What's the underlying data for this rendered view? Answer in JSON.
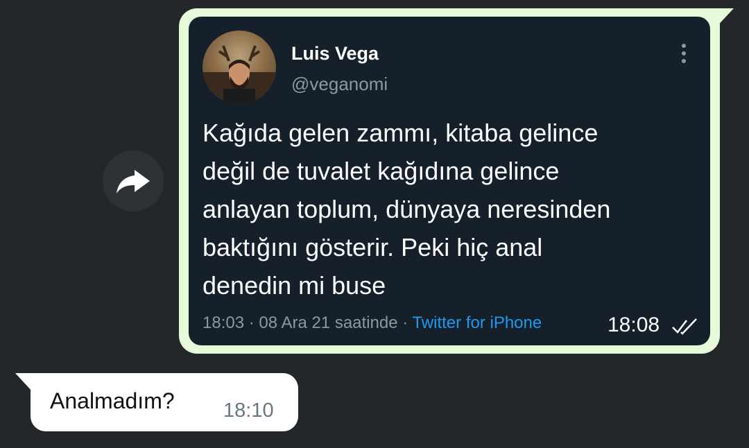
{
  "colors": {
    "chat_background": "#24272a",
    "outgoing_bubble": "#e6f9d8",
    "incoming_bubble": "#ffffff",
    "tweet_card_background": "#15202b",
    "link_blue": "#1d9bf0"
  },
  "forward_button": {
    "icon": "share-forward-icon"
  },
  "outgoing_message": {
    "tweet": {
      "author_name": "Luis Vega",
      "author_handle": "@veganomi",
      "more_icon": "vertical-ellipsis-icon",
      "text": "Kağıda gelen zammı, kitaba gelince\ndeğil de tuvalet kağıdına gelince\nanlayan toplum, dünyaya neresinden\nbaktığını gösterir. Peki hiç anal\ndenedin mi buse",
      "time": "18:03",
      "date": "08 Ara 21 saatinde",
      "separator": "·",
      "source": "Twitter for iPhone"
    },
    "time": "18:08",
    "status_icon": "double-check-icon"
  },
  "incoming_message": {
    "text": "Analmadım?",
    "time": "18:10"
  }
}
